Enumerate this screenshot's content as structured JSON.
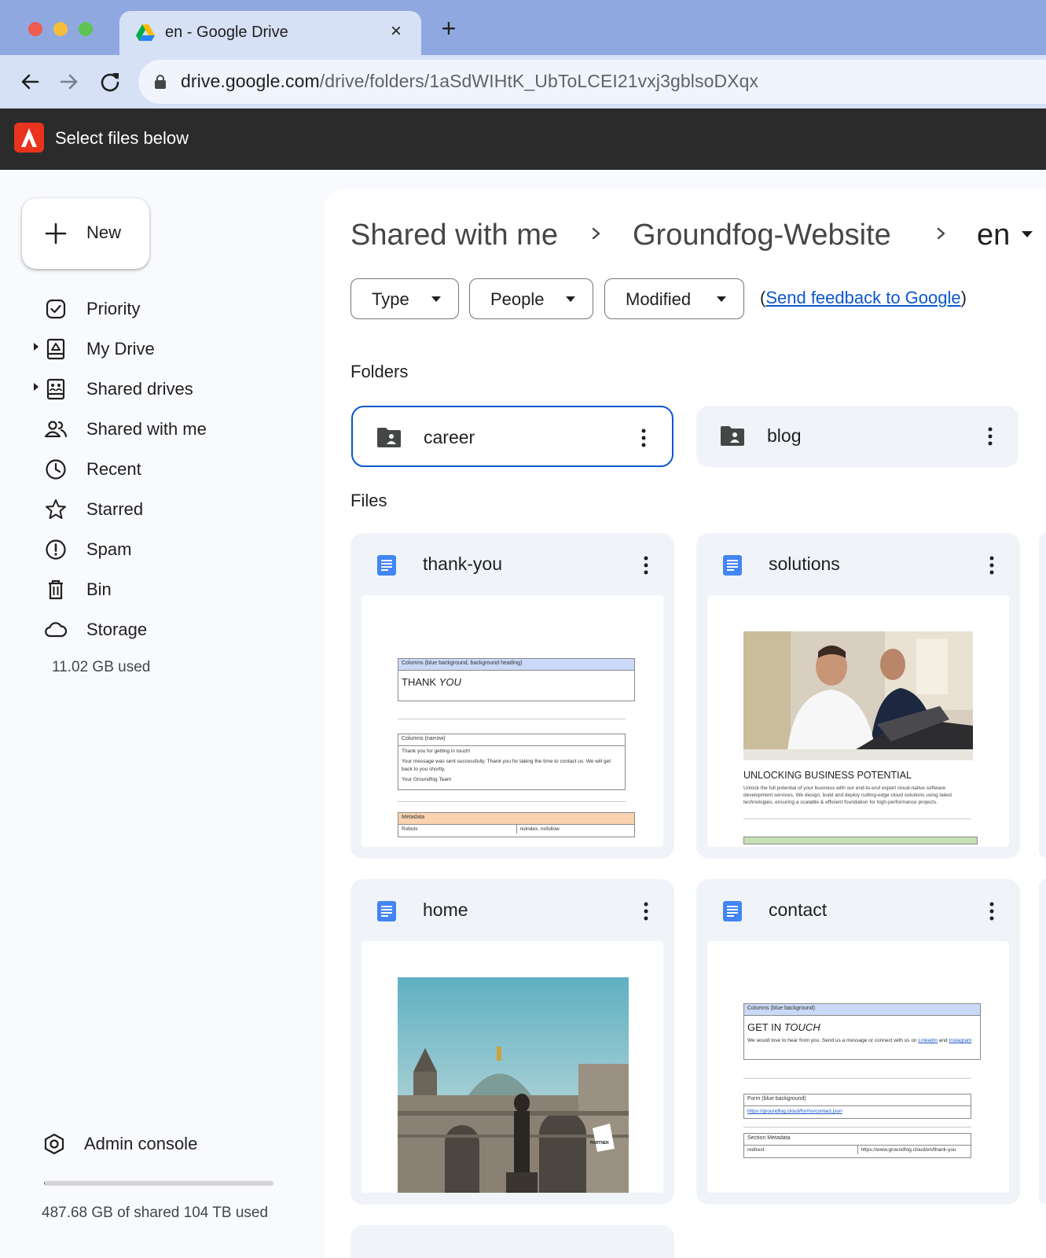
{
  "browser": {
    "tab_title": "en - Google Drive",
    "new_tab_symbol": "+",
    "url_host": "drive.google.com",
    "url_path": "/drive/folders/1aSdWIHtK_UbToLCEI21vxj3gblsoDXqx"
  },
  "extension": {
    "message": "Select files below"
  },
  "sidebar": {
    "new_label": "New",
    "items": [
      {
        "label": "Priority",
        "icon": "priority-icon"
      },
      {
        "label": "My Drive",
        "icon": "my-drive-icon"
      },
      {
        "label": "Shared drives",
        "icon": "shared-drives-icon"
      },
      {
        "label": "Shared with me",
        "icon": "shared-with-me-icon"
      },
      {
        "label": "Recent",
        "icon": "clock-icon"
      },
      {
        "label": "Starred",
        "icon": "star-icon"
      },
      {
        "label": "Spam",
        "icon": "spam-icon"
      },
      {
        "label": "Bin",
        "icon": "trash-icon"
      },
      {
        "label": "Storage",
        "icon": "cloud-icon"
      }
    ],
    "storage_used": "11.02 GB used",
    "admin_label": "Admin console",
    "quota_fraction": 0.005,
    "quota_text": "487.68 GB of shared 104 TB used"
  },
  "main": {
    "breadcrumb": [
      "Shared with me",
      "Groundfog-Website",
      "en"
    ],
    "filters": {
      "type": "Type",
      "people": "People",
      "modified": "Modified"
    },
    "feedback_open": "(",
    "feedback_link": "Send feedback to Google",
    "feedback_close": ")",
    "folders_label": "Folders",
    "folders": [
      {
        "name": "career",
        "selected": true
      },
      {
        "name": "blog",
        "selected": false
      }
    ],
    "files_label": "Files",
    "files": [
      {
        "name": "thank-you",
        "preview": {
          "header1": "Columns (blue background, background heading)",
          "heading_a": "THANK ",
          "heading_b": "YOU",
          "header2": "Columns (narrow)",
          "line1": "Thank you for getting in touch!",
          "line2": "Your message was sent successfully. Thank you for taking the time to contact us. We will get back to you shortly.",
          "line3": "Your Groundfog Team",
          "meta_header": "Metadata",
          "meta_key": "Robots",
          "meta_value": "noindex, nofollow"
        }
      },
      {
        "name": "solutions",
        "preview": {
          "heading": "UNLOCKING BUSINESS POTENTIAL",
          "body": "Unlock the full potential of your business with our end-to-end expert cloud-native software development services. We design, build and deploy cutting-edge cloud solutions using latest technologies, ensuring a scalable & efficient foundation for high-performance projects."
        }
      },
      {
        "name": "home",
        "preview": {
          "badge": "PARTNER"
        }
      },
      {
        "name": "contact",
        "preview": {
          "header1": "Columns (blue background)",
          "heading_a": "GET IN ",
          "heading_b": "TOUCH",
          "line1_a": "We would love to hear from you. Send us a message or connect with us on ",
          "line1_link1": "LinkedIn",
          "line1_b": " and ",
          "line1_link2": "Instagram",
          "form_header": "Form (blue background)",
          "form_url": "https://groundfog.cloud/forms/contact.json",
          "meta_header": "Section Metadata",
          "meta_key": "redirect",
          "meta_value": "https://www.groundfog.cloud/en/thank-you"
        }
      }
    ]
  },
  "colors": {
    "accent": "#0b57d0",
    "doc_blue": "#4285f4",
    "tab_bar": "#8fa9e0",
    "toolbar": "#d6e1f6",
    "extension_bar": "#2b2b2b",
    "adobe_red": "#e8331f"
  }
}
